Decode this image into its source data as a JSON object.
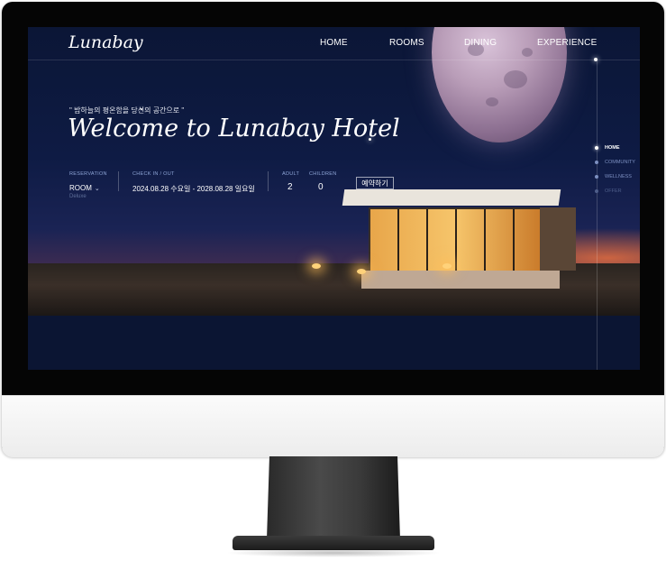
{
  "site": {
    "logo": "Lunabay",
    "nav": [
      "HOME",
      "ROOMS",
      "DINING",
      "EXPERIENCE"
    ]
  },
  "hero": {
    "tagline": "\" 밤하늘의 평온함을 당신의 공간으로 \"",
    "headline": "Welcome to Lunabay Hotel"
  },
  "reservation": {
    "reservation_label": "RESERVATION",
    "room_value": "ROOM",
    "room_sub": "Deluxe",
    "checkin_label": "CHECK IN / OUT",
    "checkin_value": "2024.08.28 수요일 - 2028.08.28 일요일",
    "adult_label": "ADULT",
    "adult_value": "2",
    "children_label": "CHILDREN",
    "children_value": "0",
    "book_button": "예약하기"
  },
  "side_nav": [
    {
      "label": "HOME",
      "active": true
    },
    {
      "label": "COMMUNITY",
      "active": false
    },
    {
      "label": "WELLNESS",
      "active": false
    },
    {
      "label": "OFFER",
      "active": false
    }
  ],
  "icons": {
    "chevron": "chevron-down-icon"
  },
  "colors": {
    "screen_bg": "#0b1533",
    "accent": "#8fa6d8",
    "text": "#ffffff"
  }
}
